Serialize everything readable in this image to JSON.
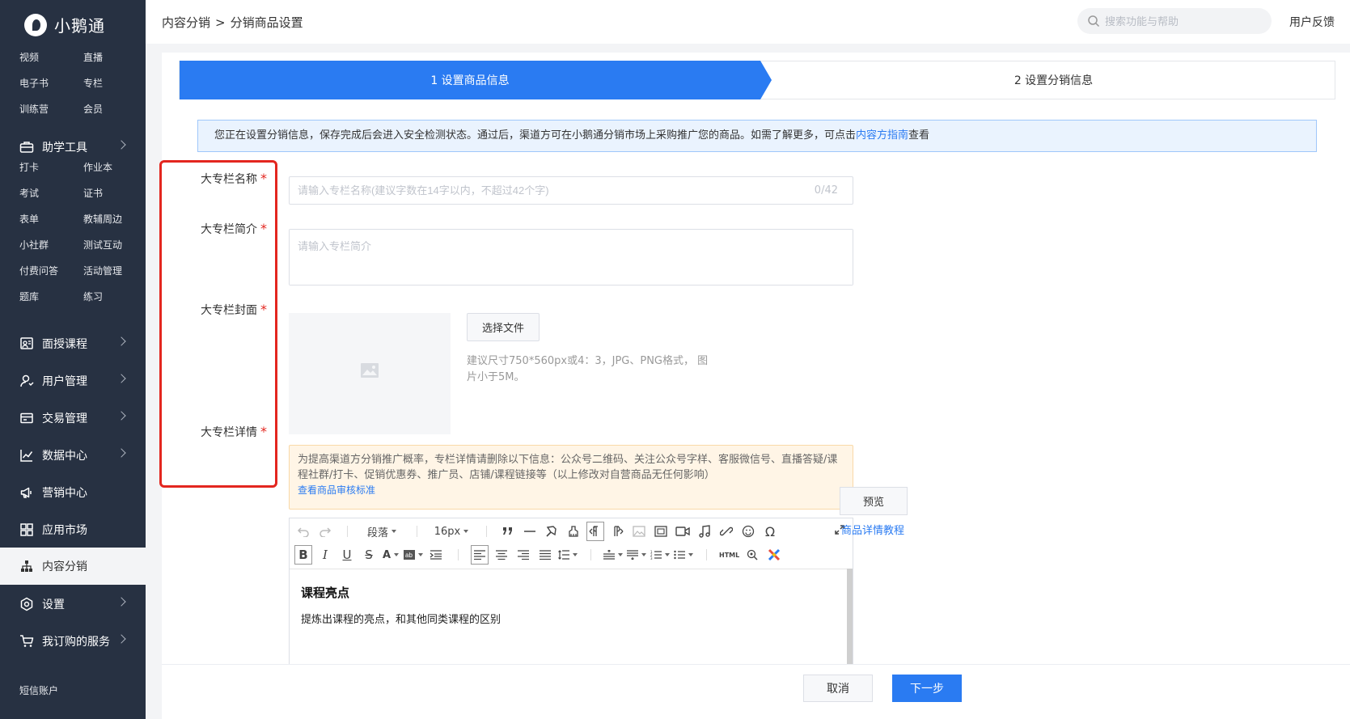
{
  "app": {
    "logo_text": "小鹅通"
  },
  "sidebar": {
    "group1": [
      "视频",
      "直播",
      "电子书",
      "专栏",
      "训练营",
      "会员"
    ],
    "tools": {
      "label": "助学工具",
      "icon": "toolbox-icon"
    },
    "group2": [
      "打卡",
      "作业本",
      "考试",
      "证书",
      "表单",
      "教辅周边",
      "小社群",
      "测试互动",
      "付费问答",
      "活动管理",
      "题库",
      "练习"
    ],
    "nav": [
      {
        "label": "面授课程",
        "icon": "classroom-icon"
      },
      {
        "label": "用户管理",
        "icon": "user-icon"
      },
      {
        "label": "交易管理",
        "icon": "wallet-icon"
      },
      {
        "label": "数据中心",
        "icon": "chart-icon"
      },
      {
        "label": "营销中心",
        "icon": "megaphone-icon"
      },
      {
        "label": "应用市场",
        "icon": "apps-icon"
      },
      {
        "label": "内容分销",
        "icon": "distribution-icon"
      },
      {
        "label": "设置",
        "icon": "settings-icon"
      },
      {
        "label": "我订购的服务",
        "icon": "cart-icon"
      }
    ],
    "short_msg": "短信账户"
  },
  "header": {
    "breadcrumb": [
      "内容分销",
      "分销商品设置"
    ],
    "breadcrumb_sep": ">",
    "search_placeholder": "搜索功能与帮助",
    "feedback": "用户反馈"
  },
  "steps": {
    "step1": "1 设置商品信息",
    "step2": "2 设置分销信息"
  },
  "notice": {
    "text": "您正在设置分销信息，保存完成后会进入安全检测状态。通过后，渠道方可在小鹅通分销市场上采购推广您的商品。如需了解更多，可点击",
    "link": "内容方指南",
    "tail": "查看"
  },
  "form": {
    "name_label": "大专栏名称",
    "name_placeholder": "请输入专栏名称(建议字数在14字以内，不超过42个字)",
    "name_counter": "0/42",
    "brief_label": "大专栏简介",
    "brief_placeholder": "请输入专栏简介",
    "cover_label": "大专栏封面",
    "cover_button": "选择文件",
    "cover_tip": "建议尺寸750*560px或4：3，JPG、PNG格式， 图片小于5M。",
    "detail_label": "大专栏详情",
    "required_mark": "*",
    "detail_warning": "为提高渠道方分销推广概率，专栏详情请删除以下信息：公众号二维码、关注公众号字样、客服微信号、直播答疑/课程社群/打卡、促销优惠券、推广员、店铺/课程链接等（以上修改对自营商品无任何影响）",
    "detail_warning_link": "查看商品审核标准"
  },
  "editor": {
    "paragraph": "段落",
    "font_size": "16px",
    "html": "HTML",
    "content_title": "课程亮点",
    "content_text": "提炼出课程的亮点，和其他同类课程的区别"
  },
  "side_actions": {
    "preview": "预览",
    "tutorial": "商品详情教程"
  },
  "footer": {
    "cancel": "取消",
    "next": "下一步"
  },
  "colors": {
    "sidebar_bg": "#273142",
    "accent": "#2a7bf2",
    "required": "#e3261f",
    "warning_bg": "#fff5e6"
  }
}
